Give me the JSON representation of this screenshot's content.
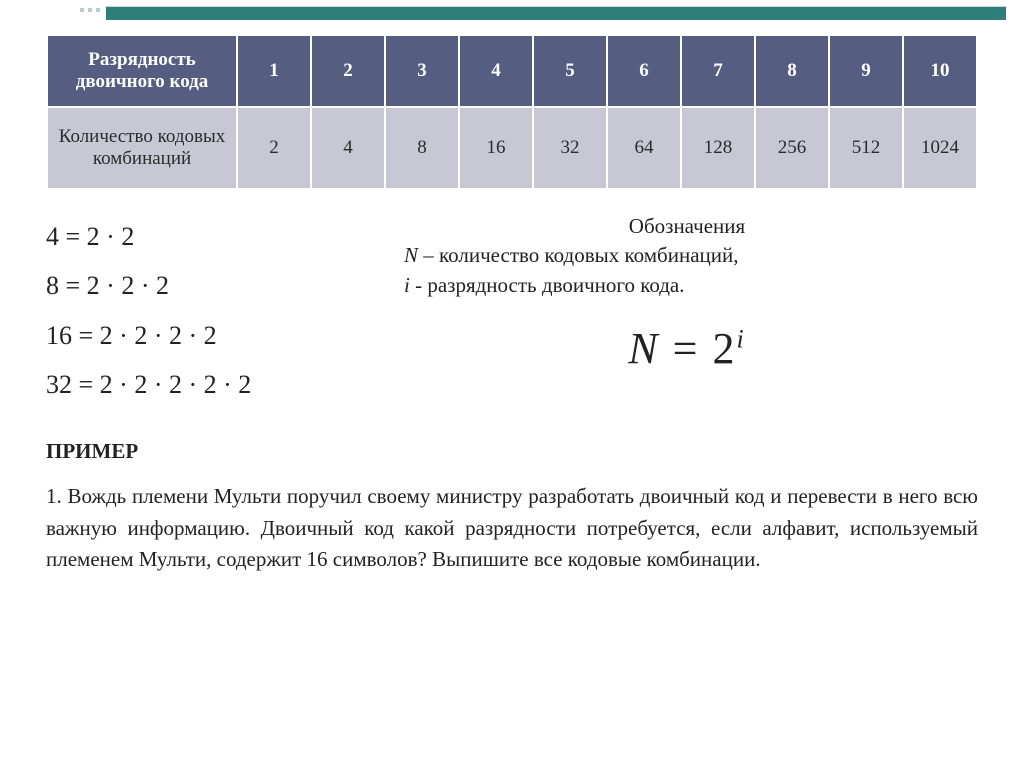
{
  "table": {
    "row1_label": "Разрядность двоичного кода",
    "row2_label": "Количество кодовых комбинаций",
    "bits": [
      "1",
      "2",
      "3",
      "4",
      "5",
      "6",
      "7",
      "8",
      "9",
      "10"
    ],
    "combs": [
      "2",
      "4",
      "8",
      "16",
      "32",
      "64",
      "128",
      "256",
      "512",
      "1024"
    ]
  },
  "equations": {
    "e1": "4 = 2 · 2",
    "e2": "8 = 2 · 2 · 2",
    "e3": "16 = 2 · 2 · 2 · 2",
    "e4": "32 = 2 · 2 · 2 · 2 · 2"
  },
  "notation": {
    "title": "Обозначения",
    "n_sym": "N",
    "n_desc": " – количество кодовых комбинаций,",
    "i_sym": "i",
    "i_desc": "  - разрядность двоичного кода.",
    "formula_N": "N",
    "formula_eq": " = 2",
    "formula_i": "i"
  },
  "example": {
    "heading": "ПРИМЕР",
    "body": "1. Вождь племени Мульти поручил своему министру разработать двоичный код и перевести в него всю важную информацию. Двоичный код какой разрядности потребуется, если алфавит, используемый племенем Мульти, содержит 16 символов? Выпишите все кодовые комбинации."
  }
}
